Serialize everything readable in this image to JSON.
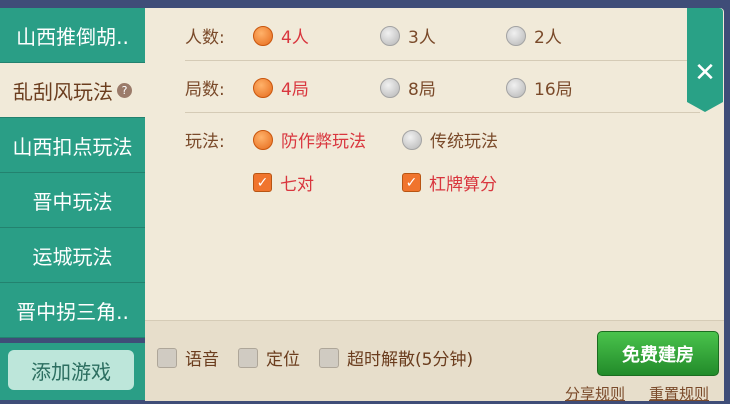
{
  "sidebar": {
    "tabs": [
      {
        "label": "山西推倒胡.."
      },
      {
        "label": "乱刮风玩法"
      },
      {
        "label": "山西扣点玩法"
      },
      {
        "label": "晋中玩法"
      },
      {
        "label": "运城玩法"
      },
      {
        "label": "晋中拐三角.."
      }
    ],
    "active_index": 1,
    "help_icon_glyph": "?",
    "add_game_label": "添加游戏"
  },
  "rules": {
    "players": {
      "label": "人数:",
      "options": [
        "4人",
        "3人",
        "2人"
      ],
      "selected": "4人"
    },
    "rounds": {
      "label": "局数:",
      "options": [
        "4局",
        "8局",
        "16局"
      ],
      "selected": "4局"
    },
    "play": {
      "label": "玩法:",
      "options": [
        "防作弊玩法",
        "传统玩法"
      ],
      "selected": "防作弊玩法",
      "extras": [
        {
          "label": "七对",
          "checked": true
        },
        {
          "label": "杠牌算分",
          "checked": true
        }
      ]
    }
  },
  "bottom": {
    "options": [
      {
        "label": "语音",
        "checked": false
      },
      {
        "label": "定位",
        "checked": false
      },
      {
        "label": "超时解散(5分钟)",
        "checked": false
      }
    ],
    "create_button": "免费建房",
    "share_rules": "分享规则",
    "reset_rules": "重置规则"
  },
  "close_glyph": "✕",
  "colors": {
    "accent_teal": "#2a9e86",
    "panel_bg": "#f1ead9",
    "selected_text": "#d9363e",
    "button_green": "#2e9f35",
    "radio_on": "#f0742d"
  }
}
